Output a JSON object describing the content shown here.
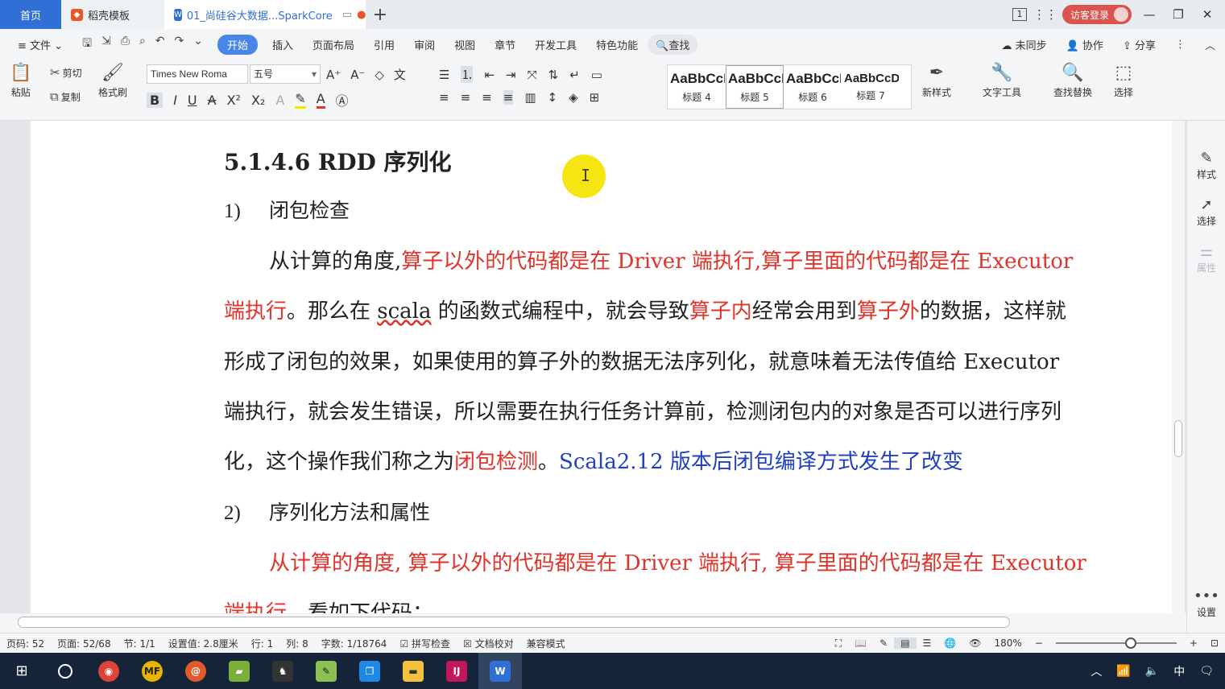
{
  "tabs": {
    "home": "首页",
    "template": "稻壳模板",
    "doc": "01_尚硅谷大数据...SparkCore",
    "new_tab": "+"
  },
  "window": {
    "login": "访客登录",
    "page_indicator": "1"
  },
  "menu": {
    "file": "文件",
    "items": [
      "开始",
      "插入",
      "页面布局",
      "引用",
      "审阅",
      "视图",
      "章节",
      "开发工具",
      "特色功能"
    ],
    "search": "查找",
    "right": [
      "未同步",
      "协作",
      "分享"
    ]
  },
  "toolbar": {
    "paste": "粘贴",
    "cut": "剪切",
    "copy": "复制",
    "format_painter": "格式刷",
    "font_name": "Times New Roma",
    "font_size": "五号",
    "new_style": "新样式",
    "text_tools": "文字工具",
    "find_replace": "查找替换",
    "select": "选择",
    "styles": [
      {
        "sample": "AaBbCcI",
        "name": "标题 4"
      },
      {
        "sample": "AaBbCcI",
        "name": "标题 5"
      },
      {
        "sample": "AaBbCcI",
        "name": "标题 6"
      },
      {
        "sample": "AaBbCcD",
        "name": "标题 7"
      }
    ]
  },
  "document": {
    "heading": "5.1.4.6 RDD 序列化",
    "item1": {
      "num": "1)",
      "text": "闭包检查"
    },
    "p1": {
      "a": "从计算的角度,",
      "b": "算子以外的代码都是在 Driver 端执行,",
      "c": "算子里面的代码都是在 Executor"
    },
    "p2": {
      "a": "端执行",
      "b": "。那么在 ",
      "c": "scala",
      "d": " 的函数式编程中，就会导致",
      "e": "算子内",
      "f": "经常会用到",
      "g": "算子外",
      "h": "的数据，这样就"
    },
    "p3": "形成了闭包的效果，如果使用的算子外的数据无法序列化，就意味着无法传值给 Executor",
    "p4": "端执行，就会发生错误，所以需要在执行任务计算前，检测闭包内的对象是否可以进行序列",
    "p5": {
      "a": "化，这个操作我们称之为",
      "b": "闭包检测",
      "c": "。",
      "d": "Scala2.12 版本后闭包编译方式发生了改变"
    },
    "item2": {
      "num": "2)",
      "text": "序列化方法和属性"
    },
    "p6": "从计算的角度, 算子以外的代码都是在 Driver 端执行, 算子里面的代码都是在 Executor",
    "p7": {
      "a": "端执行",
      "b": "，看如下代码："
    }
  },
  "right_panel": [
    "样式",
    "选择",
    "属性",
    "设置"
  ],
  "status": {
    "page_no": "页码: 52",
    "pages": "页面: 52/68",
    "section": "节: 1/1",
    "setting": "设置值: 2.8厘米",
    "row": "行: 1",
    "col": "列: 8",
    "words": "字数: 1/18764",
    "spell": "拼写检查",
    "proof": "文档校对",
    "compat": "兼容模式",
    "zoom": "180%"
  },
  "taskbar": {
    "ime": "中"
  },
  "colors": {
    "red_text": "#e0332a",
    "blue_text": "#2040c0",
    "accent": "#4a86e8"
  }
}
